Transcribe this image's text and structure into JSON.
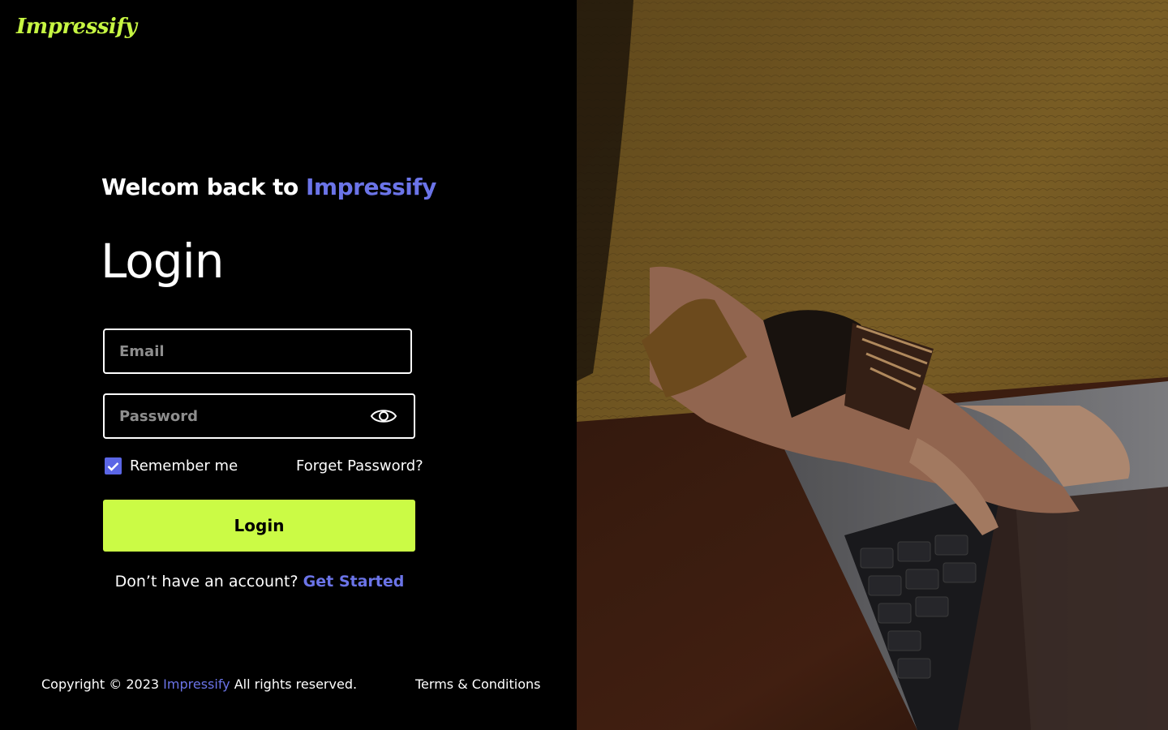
{
  "brand": {
    "name": "Impressify",
    "logo_color": "#c6f542",
    "accent_color": "#6b74e8"
  },
  "header": {
    "welcome_prefix": "Welcom back to",
    "welcome_brand": "Impressify"
  },
  "form": {
    "title": "Login",
    "email_placeholder": "Email",
    "email_value": "",
    "password_placeholder": "Password",
    "password_value": "",
    "password_toggle_icon": "eye-icon",
    "remember_label": "Remember me",
    "remember_checked": true,
    "forget_label": "Forget Password?",
    "submit_label": "Login",
    "button_color": "#cbfb45"
  },
  "signup": {
    "prompt": "Don’t have an account?",
    "link_label": "Get Started"
  },
  "footer": {
    "copyright_prefix": "Copyright © 2023",
    "copyright_brand": "Impressify",
    "copyright_suffix": "All rights reserved.",
    "terms_label": "Terms & Conditions"
  }
}
